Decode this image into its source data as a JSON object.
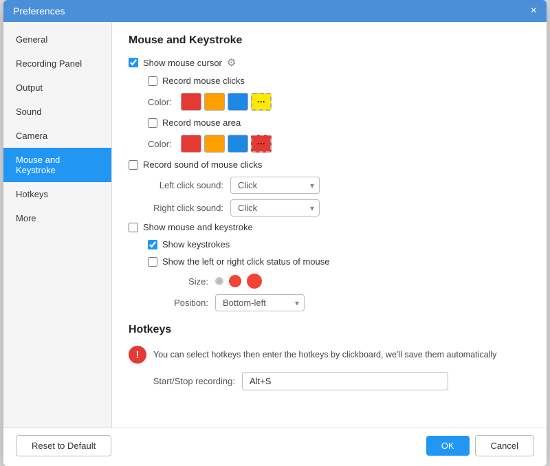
{
  "dialog": {
    "title": "Preferences",
    "close_icon": "×"
  },
  "sidebar": {
    "items": [
      {
        "label": "General",
        "active": false
      },
      {
        "label": "Recording Panel",
        "active": false
      },
      {
        "label": "Output",
        "active": false
      },
      {
        "label": "Sound",
        "active": false
      },
      {
        "label": "Camera",
        "active": false
      },
      {
        "label": "Mouse and Keystroke",
        "active": true
      },
      {
        "label": "Hotkeys",
        "active": false
      },
      {
        "label": "More",
        "active": false
      }
    ]
  },
  "mouse_keystroke": {
    "section_title": "Mouse and Keystroke",
    "show_mouse_cursor_label": "Show mouse cursor",
    "record_mouse_clicks_label": "Record mouse clicks",
    "color_label": "Color:",
    "record_mouse_area_label": "Record mouse area",
    "color_label2": "Color:",
    "record_sound_label": "Record sound of mouse clicks",
    "left_click_sound_label": "Left click sound:",
    "left_click_sound_value": "Click",
    "right_click_sound_label": "Right click sound:",
    "right_click_sound_value": "Click",
    "show_mouse_keystroke_label": "Show mouse and keystroke",
    "show_keystrokes_label": "Show keystrokes",
    "show_click_status_label": "Show the left or right click status of mouse",
    "size_label": "Size:",
    "position_label": "Position:",
    "position_value": "Bottom-left",
    "colors1": [
      "#e53935",
      "#ffa000",
      "#1e88e5",
      "#ffe900"
    ],
    "colors2": [
      "#e53935",
      "#ffa000",
      "#1e88e5",
      "#e53935"
    ],
    "checkboxes": {
      "show_mouse_cursor": true,
      "record_mouse_clicks": false,
      "record_mouse_area": false,
      "record_sound": false,
      "show_mouse_keystroke": false,
      "show_keystrokes": true,
      "show_click_status": false
    }
  },
  "hotkeys": {
    "section_title": "Hotkeys",
    "info_text": "You can select hotkeys then enter the hotkeys by clickboard, we'll save them automatically",
    "start_stop_label": "Start/Stop recording:",
    "start_stop_value": "Alt+S"
  },
  "footer": {
    "reset_label": "Reset to Default",
    "ok_label": "OK",
    "cancel_label": "Cancel"
  }
}
